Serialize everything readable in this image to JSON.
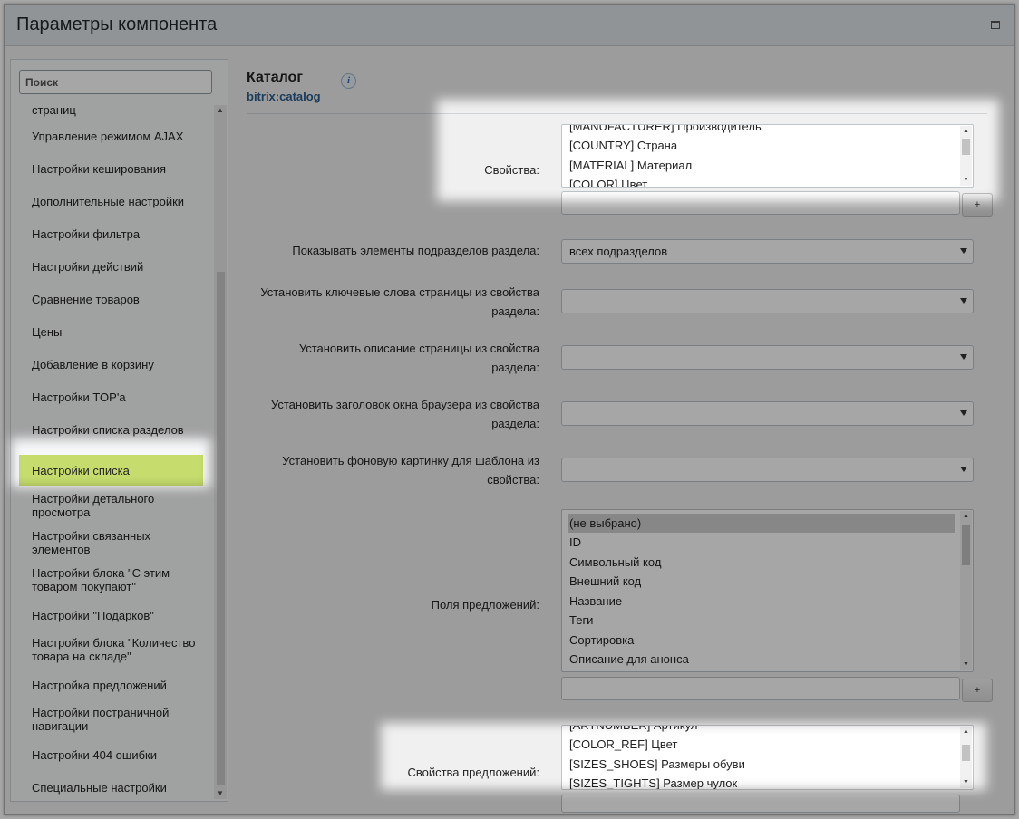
{
  "window": {
    "title": "Параметры компонента"
  },
  "sidebar": {
    "search_placeholder": "Поиск",
    "items": [
      "страниц",
      "Управление режимом AJAX",
      "Настройки кеширования",
      "Дополнительные настройки",
      "Настройки фильтра",
      "Настройки действий",
      "Сравнение товаров",
      "Цены",
      "Добавление в корзину",
      "Настройки TOP'a",
      "Настройки списка разделов",
      "Настройки списка",
      "Настройки детального просмотра",
      "Настройки связанных элементов",
      "Настройки блока \"С этим товаром покупают\"",
      "Настройки \"Подарков\"",
      "Настройки блока \"Количество товара на складе\"",
      "Настройка предложений",
      "Настройки постраничной навигации",
      "Настройки 404 ошибки",
      "Специальные настройки"
    ],
    "active_item": "Настройки списка"
  },
  "component": {
    "title": "Каталог",
    "code": "bitrix:catalog",
    "info_icon": "info-icon"
  },
  "fields": {
    "properties": {
      "label": "Свойства:",
      "options": [
        "[MANUFACTURER] Производитель",
        "[COUNTRY] Страна",
        "[MATERIAL] Материал",
        "[COLOR] Цвет"
      ],
      "add_label": "+"
    },
    "show_subsection_elements": {
      "label": "Показывать элементы подразделов раздела:",
      "value": "всех подразделов"
    },
    "meta_keywords": {
      "label": "Установить ключевые слова страницы из свойства раздела:",
      "value": ""
    },
    "meta_description": {
      "label": "Установить описание страницы из свойства раздела:",
      "value": ""
    },
    "browser_title": {
      "label": "Установить заголовок окна браузера из свойства раздела:",
      "value": ""
    },
    "background_image": {
      "label": "Установить фоновую картинку для шаблона из свойства:",
      "value": ""
    },
    "offer_fields": {
      "label": "Поля предложений:",
      "options": [
        "(не выбрано)",
        "ID",
        "Символьный код",
        "Внешний код",
        "Название",
        "Теги",
        "Сортировка",
        "Описание для анонса"
      ],
      "add_label": "+"
    },
    "offer_properties": {
      "label": "Свойства предложений:",
      "options": [
        "[ARTNUMBER] Артикул",
        "[COLOR_REF] Цвет",
        "[SIZES_SHOES] Размеры обуви",
        "[SIZES_TIGHTS] Размер чулок"
      ]
    }
  },
  "highlight": {
    "dim_color": "#000000",
    "dim_opacity": 0.35
  }
}
